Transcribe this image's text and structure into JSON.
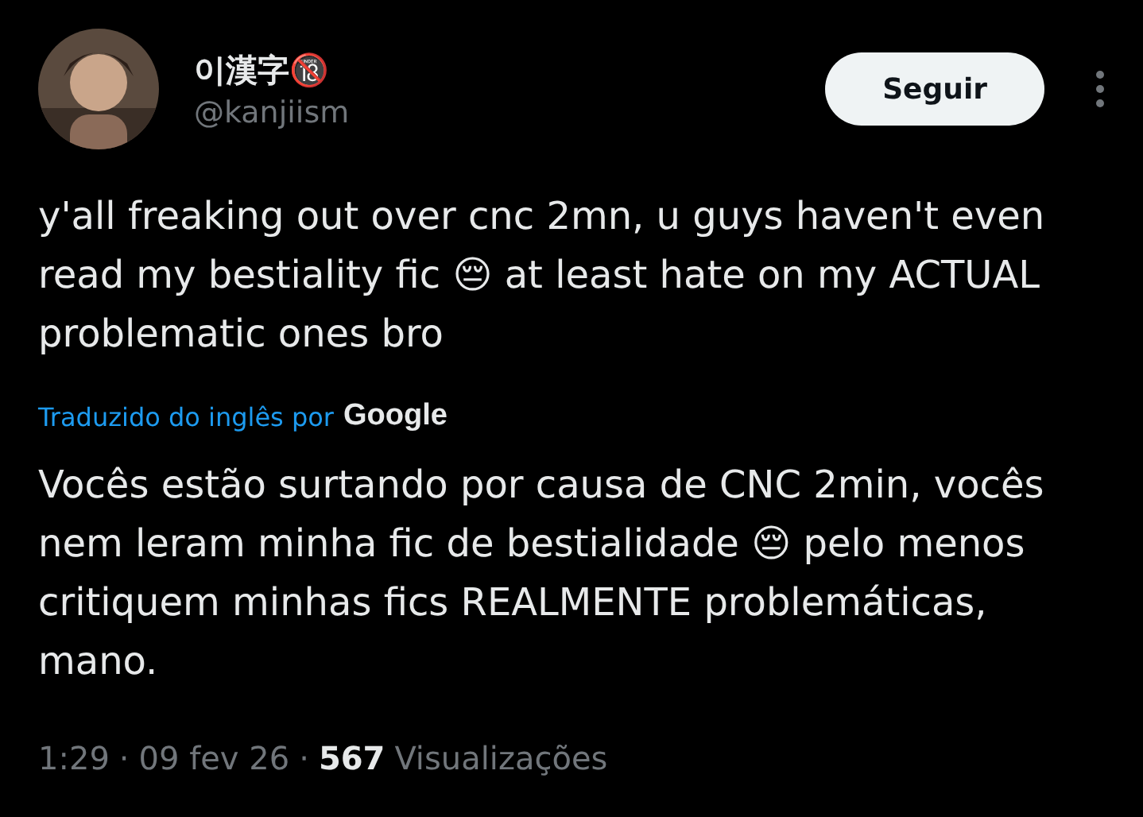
{
  "author": {
    "name": "이漢字🔞",
    "handle": "@kanjiism"
  },
  "follow_button": "Seguir",
  "tweet_text": "y'all freaking out over cnc 2mn, u guys haven't even read my bestiality fic 😔 at least hate on my ACTUAL problematic ones bro",
  "translation": {
    "label": "Traduzido do inglês por",
    "provider": "Google",
    "text": "Vocês estão surtando por causa de CNC 2min, vocês nem leram minha fic de bestialidade 😔 pelo menos critiquem minhas fics REALMENTE problemáticas, mano."
  },
  "meta": {
    "time": "1:29",
    "separator_1": "·",
    "date": "09 fev 26",
    "separator_2": "·",
    "views_count": "567",
    "views_label": "Visualizações"
  }
}
